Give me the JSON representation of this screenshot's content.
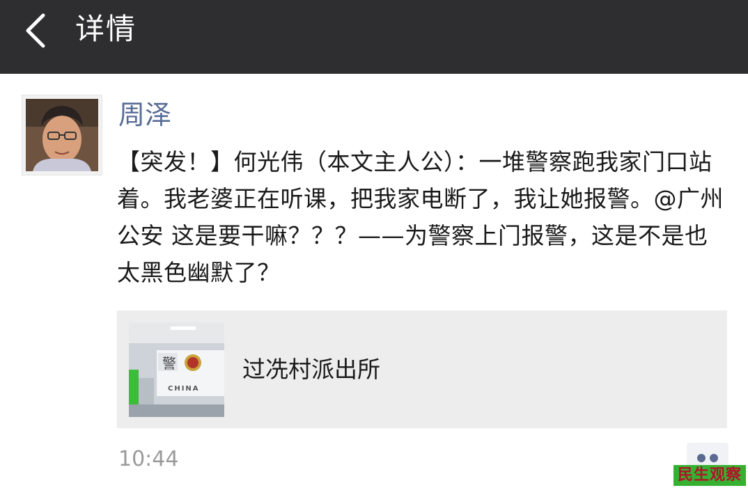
{
  "navbar": {
    "back_icon": "chevron-left-icon",
    "title": "详情",
    "background": "#2e2e30"
  },
  "post": {
    "author": "周泽",
    "author_color": "#576b95",
    "text": "【突发！】何光伟（本文主人公）：一堆警察跑我家门口站着。我老婆正在听课，把我家电断了，我让她报警。@广州公安 这是要干嘛？？？——为警察上门报警，这是不是也太黑色幽默了？",
    "link_card": {
      "title": "过冼村派出所",
      "thumbnail_sign_char": "警",
      "thumbnail_sign_text": "CHINA"
    },
    "time": "10:44",
    "comment_icon": "comment-dots-icon"
  },
  "watermark": {
    "text": "民生观察",
    "background": "#36b030",
    "color": "#b3122a"
  }
}
